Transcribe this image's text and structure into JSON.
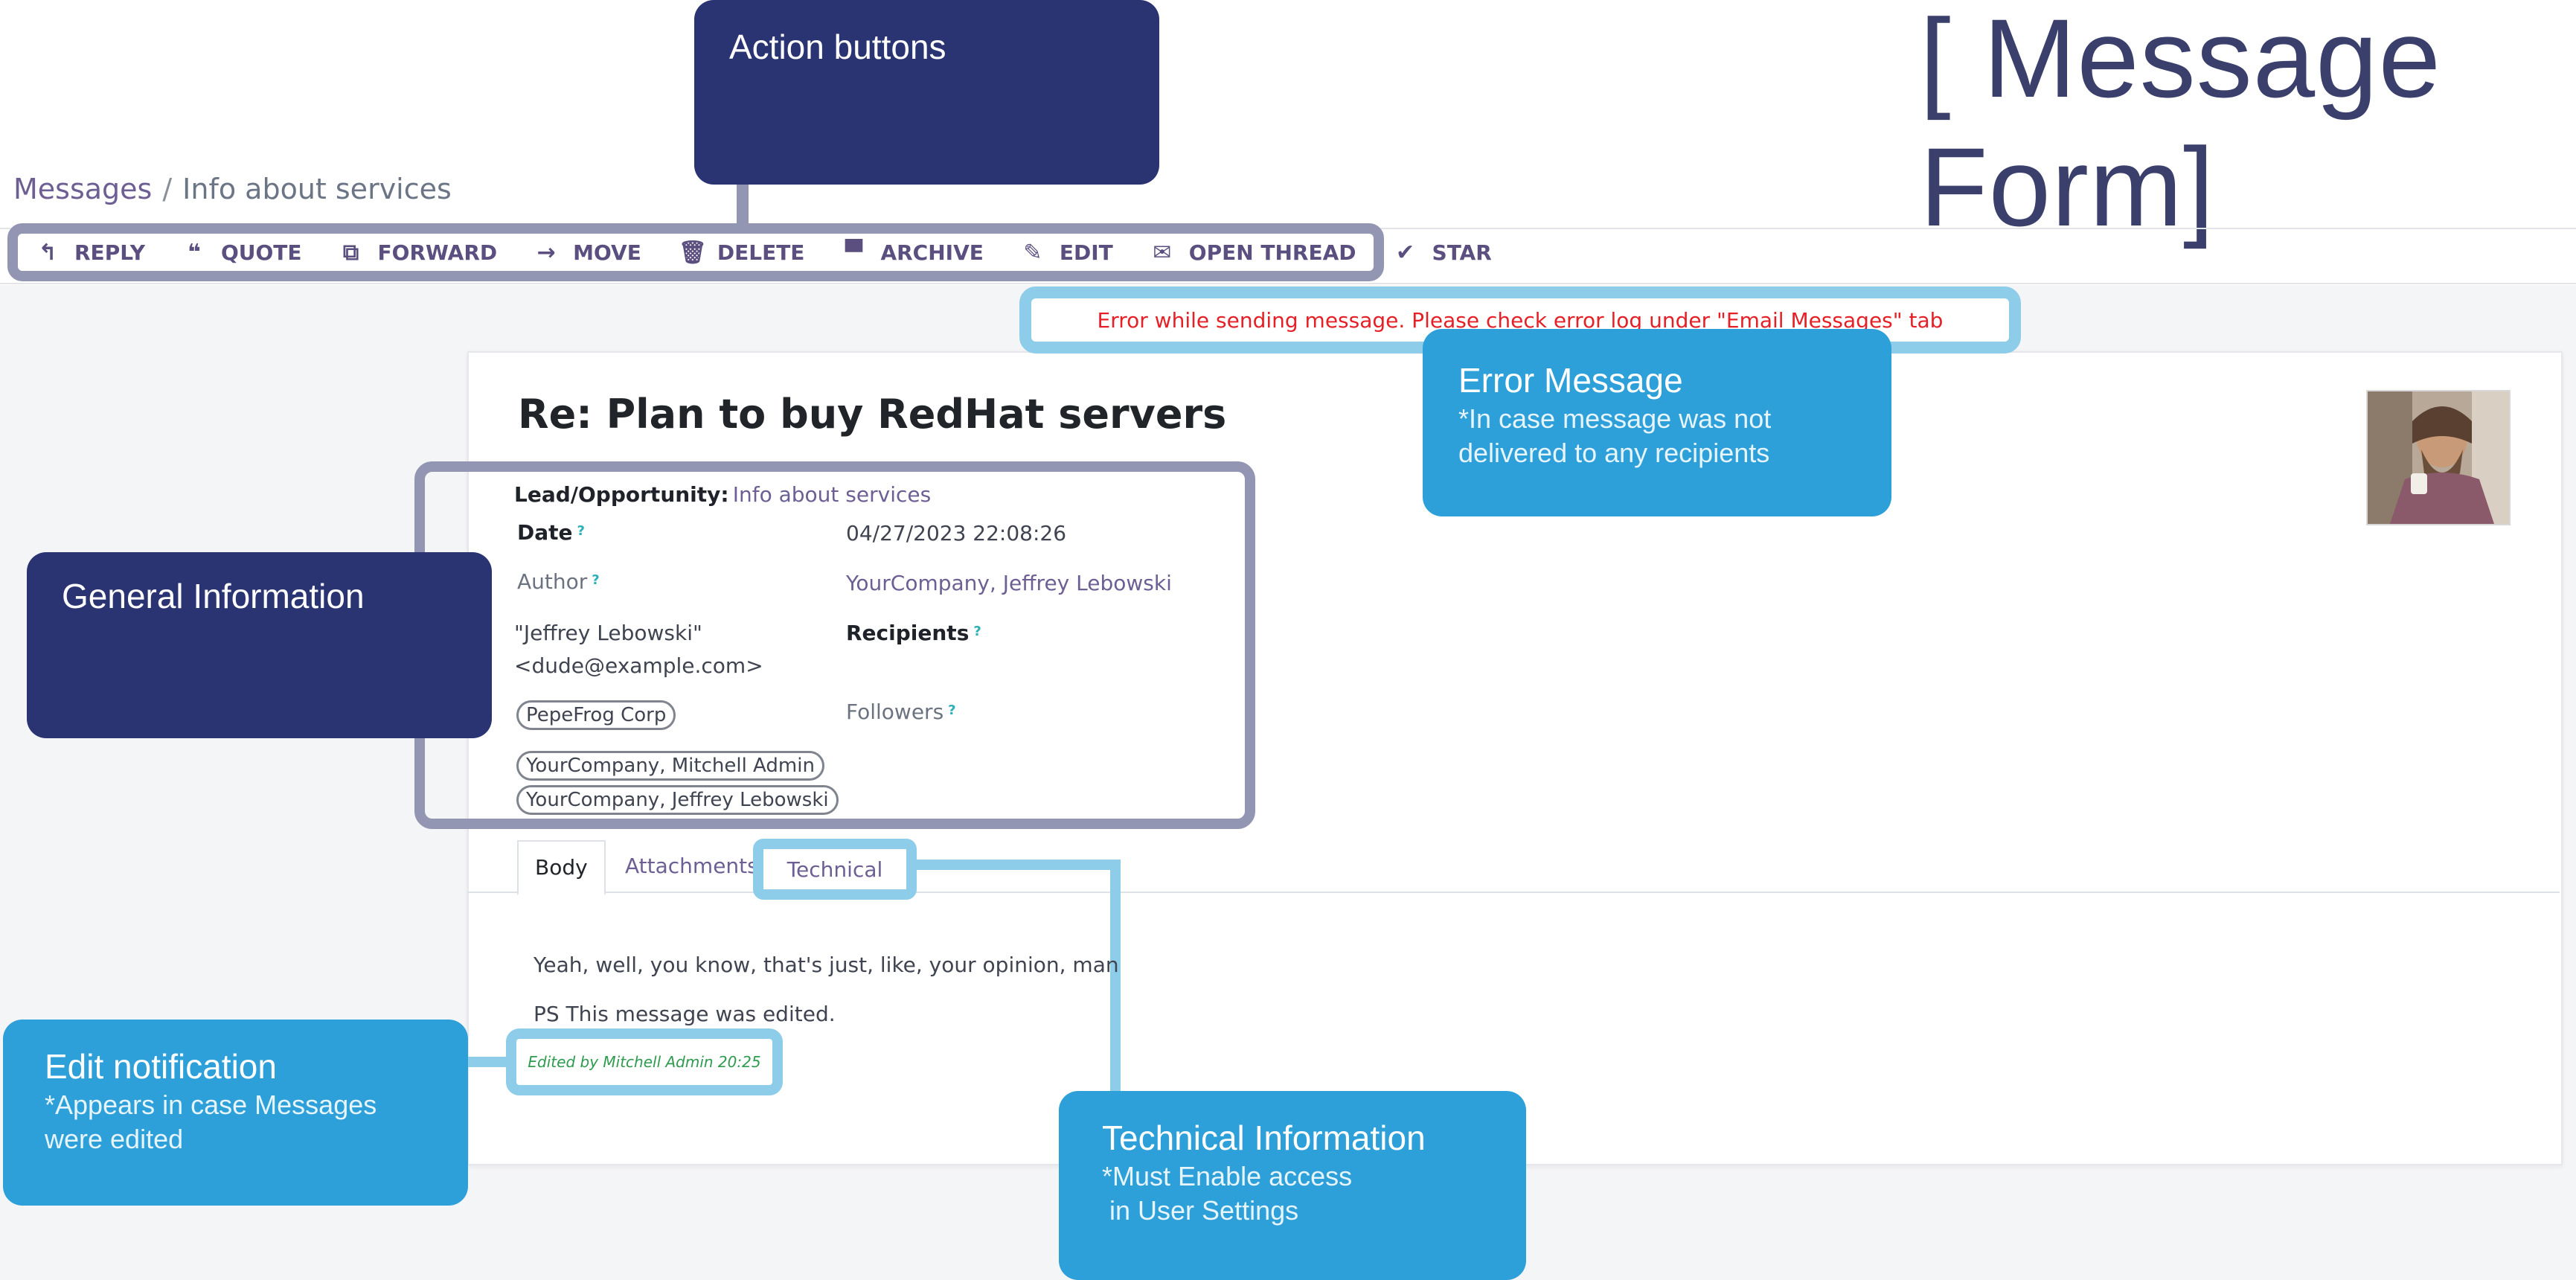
{
  "page_heading": "[ Message Form]",
  "breadcrumb": {
    "root": "Messages",
    "separator": "/",
    "current": "Info about services"
  },
  "toolbar": {
    "buttons": [
      {
        "label": "REPLY",
        "icon": "reply-icon",
        "glyph": "↰"
      },
      {
        "label": "QUOTE",
        "icon": "quote-icon",
        "glyph": "❝"
      },
      {
        "label": "FORWARD",
        "icon": "forward-icon",
        "glyph": "⧉"
      },
      {
        "label": "MOVE",
        "icon": "arrow-right-icon",
        "glyph": "→"
      },
      {
        "label": "DELETE",
        "icon": "trash-icon",
        "glyph": "🗑"
      },
      {
        "label": "ARCHIVE",
        "icon": "archive-icon",
        "glyph": "▀"
      },
      {
        "label": "EDIT",
        "icon": "edit-icon",
        "glyph": "✎"
      },
      {
        "label": "OPEN THREAD",
        "icon": "envelope-icon",
        "glyph": "✉"
      },
      {
        "label": "STAR",
        "icon": "check-icon",
        "glyph": "✔"
      }
    ]
  },
  "error_banner": "Error while sending message. Please check error log under \"Email Messages\" tab",
  "message": {
    "subject": "Re: Plan to buy RedHat servers",
    "lead_label": "Lead/Opportunity:",
    "lead_value": "Info about services",
    "date_label": "Date",
    "date_value": "04/27/2023 22:08:26",
    "author_label": "Author",
    "author_value": "YourCompany, Jeffrey Lebowski",
    "from_line1": "\"Jeffrey Lebowski\"",
    "from_line2": "<dude@example.com>",
    "recipients_label": "Recipients",
    "recipient_chip": "PepeFrog Corp",
    "followers_label": "Followers",
    "follower_chips": [
      "YourCompany, Mitchell Admin",
      "YourCompany, Jeffrey Lebowski"
    ],
    "help_mark": "?"
  },
  "tabs": {
    "body": "Body",
    "attachments": "Attachments",
    "technical": "Technical"
  },
  "body": {
    "line1": "Yeah, well, you know, that's just, like, your opinion, man",
    "line2": "PS This message was edited.",
    "edited_note": "Edited by Mitchell Admin 20:25"
  },
  "callouts": {
    "action_buttons": {
      "title": "Action buttons"
    },
    "general_info": {
      "title": "General Information"
    },
    "error_message": {
      "title": "Error Message",
      "note_line1": "*In case message was not",
      "note_line2": "delivered to any recipients"
    },
    "edit_notification": {
      "title": "Edit notification",
      "note_line1": "*Appears in case Messages",
      "note_line2": "were edited"
    },
    "technical_info": {
      "title": "Technical Information",
      "note_line1": "*Must Enable access",
      "note_line2": " in User Settings"
    }
  },
  "colors": {
    "callout_dark": "#2b3472",
    "callout_light": "#2d9fd9",
    "highlight_gray": "#9296b3",
    "highlight_blue": "#8ecdea",
    "error_text": "#e52027",
    "link": "#6d5f93"
  }
}
